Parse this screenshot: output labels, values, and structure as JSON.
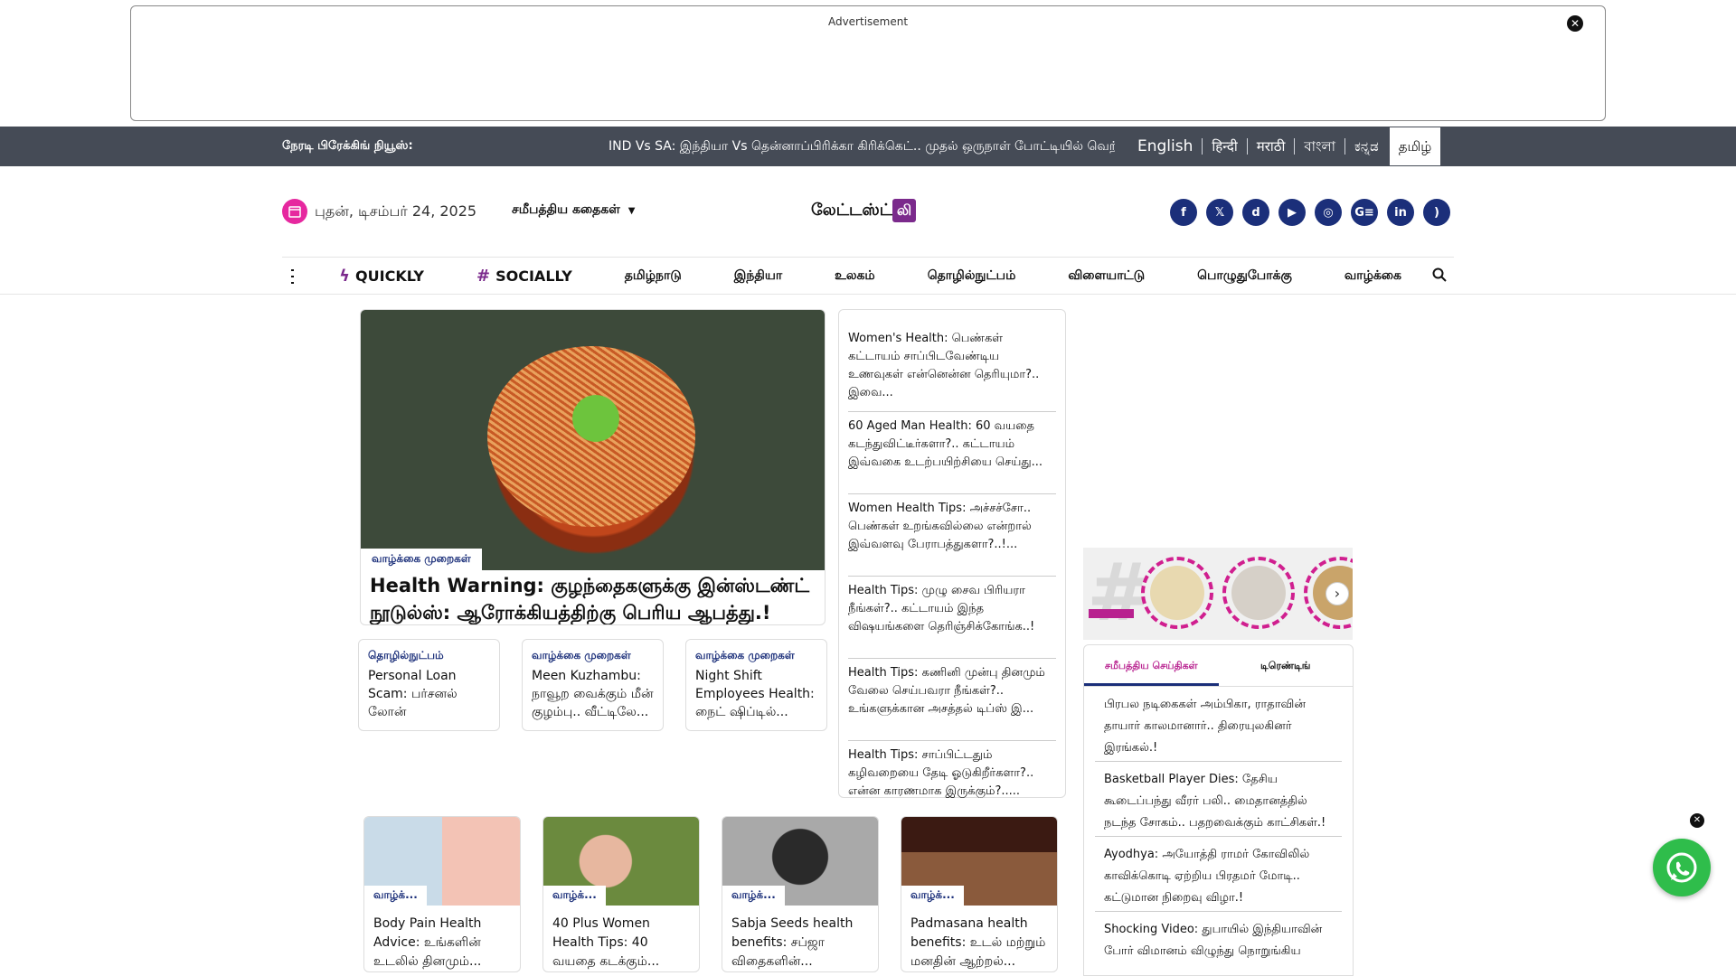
{
  "ad": {
    "label": "Advertisement",
    "close": "✕"
  },
  "ticker": {
    "label": "நேரடி பிரேக்கிங் நியூஸ்:",
    "text": "IND Vs SA: இந்தியா Vs தென்னாப்பிரிக்கா கிரிக்கெட்.. முதல் ஒருநாள் போட்டியில் வெற்றி யாரு"
  },
  "languages": [
    "English",
    "हिन्दी",
    "मराठी",
    "বাংলা",
    "ಕನ್ನಡ",
    "தமிழ்"
  ],
  "header": {
    "date": "புதன், டிசம்பர் 24, 2025",
    "recent_label": "சமீபத்திய கதைகள்",
    "logo_text": "லேட்டஸ்ட்",
    "logo_mark": "லி"
  },
  "socials": [
    {
      "name": "facebook",
      "glyph": "f"
    },
    {
      "name": "x",
      "glyph": "𝕏"
    },
    {
      "name": "dailyhunt",
      "glyph": "d"
    },
    {
      "name": "youtube",
      "glyph": "▶"
    },
    {
      "name": "instagram",
      "glyph": "◎"
    },
    {
      "name": "google-news",
      "glyph": "G≡"
    },
    {
      "name": "linkedin",
      "glyph": "in"
    },
    {
      "name": "rss",
      "glyph": ")"
    }
  ],
  "nav": {
    "quickly": "QUICKLY",
    "socially": "SOCIALLY",
    "items": [
      "தமிழ்நாடு",
      "இந்தியா",
      "உலகம்",
      "தொழில்நுட்பம்",
      "விளையாட்டு",
      "பொழுதுபோக்கு",
      "வாழ்க்கை"
    ]
  },
  "hero": {
    "category": "வாழ்க்கை முறைகள்",
    "title": "Health Warning: குழந்தைகளுக்கு இன்ஸ்டண்ட் நூடுல்ஸ்: ஆரோக்கியத்திற்கு பெரிய ஆபத்து.!"
  },
  "mini_cards": [
    {
      "category": "தொழில்நுட்பம்",
      "title": "Personal Loan Scam: பர்சனல் லோன் மோசடிகள்....."
    },
    {
      "category": "வாழ்க்கை முறைகள்",
      "title": "Meen Kuzhambu: நாவூற வைக்கும் மீன் குழம்பு.. வீட்டிலே..."
    },
    {
      "category": "வாழ்க்கை முறைகள்",
      "title": "Night Shift Employees Health: நைட் ஷிப்டில்..."
    }
  ],
  "side_list": [
    "Women's Health: பெண்கள் கட்டாயம் சாப்பிடவேண்டிய உணவுகள் என்னென்ன தெரியுமா?.. இவை...",
    "60 Aged Man Health: 60 வயதை கடந்துவிட்டீர்களா?.. கட்டாயம் இவ்வகை உடற்பயிற்சியை செய்து...",
    "Women Health Tips: அச்சச்சோ.. பெண்கள் உறங்கவில்லை என்றால் இவ்வளவு பேராபத்துகளா?..!...",
    "Health Tips: முழு சைவ பிரியரா நீங்கள்?.. கட்டாயம் இந்த விஷயங்களை தெரிஞ்சிக்கோங்க..!",
    "Health Tips: கணினி முன்பு தினமும் வேலை செய்பவரா நீங்கள்?.. உங்களுக்கான அசத்தல் டிப்ஸ் இ...",
    "Health Tips: சாப்பிட்டதும் கழிவறையை தேடி ஓடுகிறீர்களா?.. என்ன காரணமாக இருக்கும்?....."
  ],
  "cards": [
    {
      "category": "வாழ்க்...",
      "title": "Body Pain Health Advice: உங்களின் உடலில் தினமும்...",
      "color": "#c9dbe8"
    },
    {
      "category": "வாழ்க்...",
      "title": "40 Plus Women Health Tips: 40 வயதை கடக்கும்...",
      "color": "#c98e72"
    },
    {
      "category": "வாழ்க்...",
      "title": "Sabja Seeds health benefits: சப்ஜா விதைகளின்...",
      "color": "#9b9b9b"
    },
    {
      "category": "வாழ்க்...",
      "title": "Padmasana health benefits: உடல் மற்றும் மனதின் ஆற்றல்...",
      "color": "#5a2a1c"
    }
  ],
  "tabs": {
    "recent": "சமீபத்திய செய்திகள்",
    "trending": "டிரெண்டிங்"
  },
  "tab_list": [
    "பிரபல நடிகைகள் அம்பிகா, ராதாவின் தாயார் காலமானார்.. திரையுலகினர் இரங்கல்.!",
    "Basketball Player Dies: தேசிய கூடைப்பந்து வீரர் பலி.. மைதானத்தில் நடந்த சோகம்.. பதறவைக்கும் காட்சிகள்.!",
    "Ayodhya: அயோத்தி ராமர் கோவிலில் காவிக்கொடி ஏற்றிய பிரதமர் மோடி.. கட்டுமான நிறைவு விழா.!",
    "Shocking Video: துபாயில் இந்தியாவின் போர் விமானம் விழுந்து நொறுங்கிய"
  ],
  "colors": {
    "accent": "#b8218f",
    "navy": "#1b2f7a",
    "ticker_bg": "#454b56",
    "whatsapp": "#2fbd4b"
  }
}
